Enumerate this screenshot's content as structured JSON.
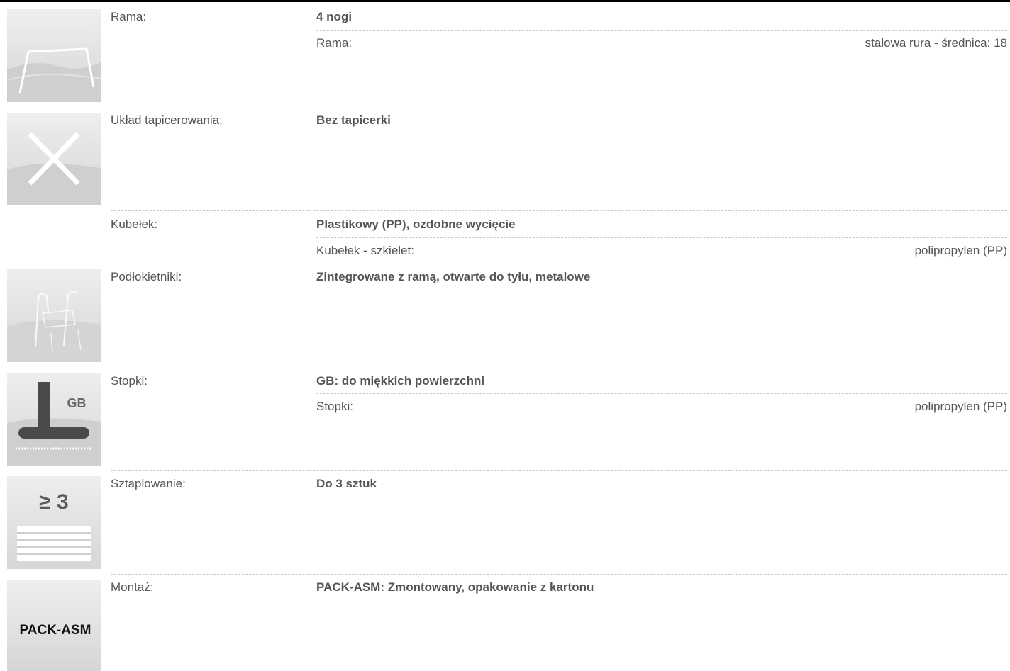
{
  "rows": [
    {
      "id": "rama",
      "label": "Rama:",
      "value": "4 nogi",
      "sub": {
        "label": "Rama:",
        "value": "stalowa rura - średnica: 18"
      },
      "icon": "frame-4-legs-icon"
    },
    {
      "id": "uklad",
      "label": "Układ tapicerowania:",
      "value": "Bez tapicerki",
      "icon": "no-upholstery-x-icon"
    },
    {
      "id": "kubelek",
      "label": "Kubełek:",
      "value": "Plastikowy (PP), ozdobne wycięcie",
      "sub": {
        "label": "Kubełek - szkielet:",
        "value": "polipropylen (PP)"
      }
    },
    {
      "id": "podlokietniki",
      "label": "Podłokietniki:",
      "value": "Zintegrowane z ramą, otwarte do tyłu, metalowe",
      "icon": "armrest-icon"
    },
    {
      "id": "stopki",
      "label": "Stopki:",
      "value": "GB: do miękkich powierzchni",
      "sub": {
        "label": "Stopki:",
        "value": "polipropylen (PP)"
      },
      "icon": "glide-gb-icon",
      "icon_text": "GB"
    },
    {
      "id": "sztaplowanie",
      "label": "Sztaplowanie:",
      "value": "Do 3 sztuk",
      "icon": "stacking-icon",
      "icon_text": "≥ 3"
    },
    {
      "id": "montaz",
      "label": "Montaż:",
      "value": "PACK-ASM: Zmontowany, opakowanie z kartonu",
      "icon": "pack-asm-icon",
      "icon_text": "PACK-ASM"
    }
  ]
}
